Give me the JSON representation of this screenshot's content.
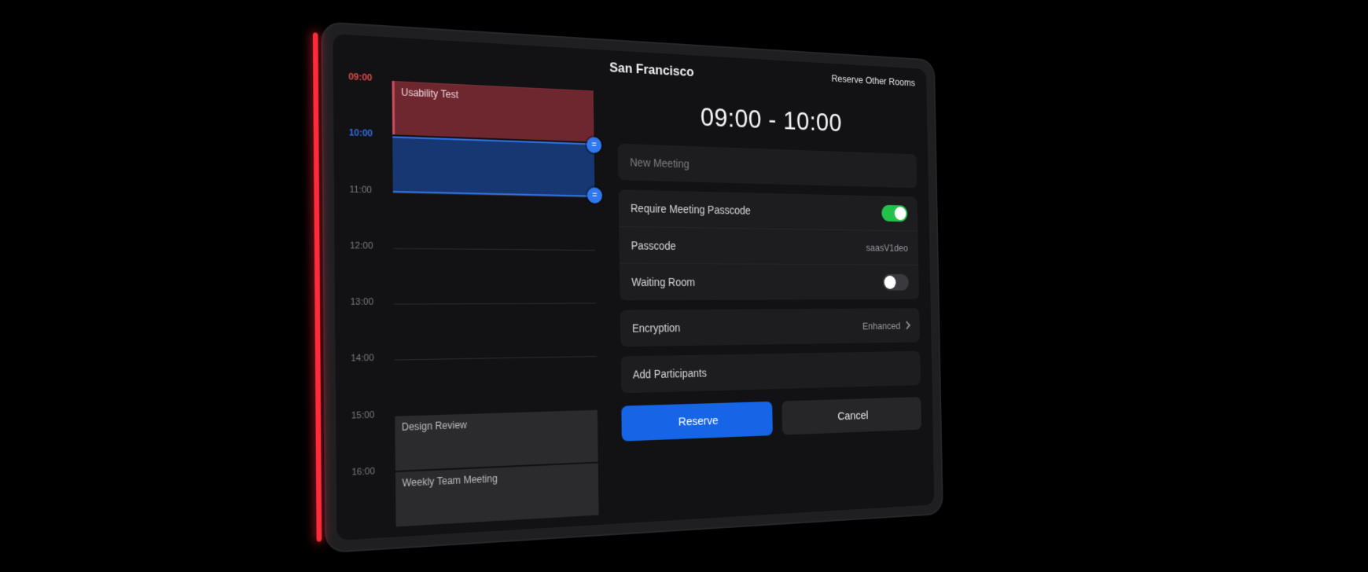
{
  "header": {
    "room_name": "San Francisco",
    "reserve_other_label": "Reserve Other Rooms"
  },
  "timeline": {
    "hours": [
      "09:00",
      "10:00",
      "11:00",
      "12:00",
      "13:00",
      "14:00",
      "15:00",
      "16:00"
    ],
    "highlight_index": 0,
    "selection": {
      "start_index": 1,
      "end_index": 2
    },
    "blocks": [
      {
        "title": "Usability Test",
        "start_index": 0,
        "end_index": 1,
        "kind": "busy"
      },
      {
        "title": "Design Review",
        "start_index": 6,
        "end_index": 7,
        "kind": "soft"
      },
      {
        "title": "Weekly Team Meeting",
        "start_index": 7,
        "end_index": 8,
        "kind": "soft"
      }
    ]
  },
  "time_range": "09:00 - 10:00",
  "form": {
    "meeting_name_placeholder": "New Meeting",
    "require_passcode": {
      "label": "Require Meeting Passcode",
      "on": true
    },
    "passcode": {
      "label": "Passcode",
      "value": "saasV1deo"
    },
    "waiting_room": {
      "label": "Waiting Room",
      "on": false
    },
    "encryption": {
      "label": "Encryption",
      "value": "Enhanced"
    },
    "add_participants": {
      "label": "Add Participants"
    }
  },
  "actions": {
    "primary": "Reserve",
    "secondary": "Cancel"
  },
  "colors": {
    "primary": "#1565e6",
    "busy": "#c94a5a",
    "success": "#22c14a",
    "led": "#ff2b3a"
  }
}
